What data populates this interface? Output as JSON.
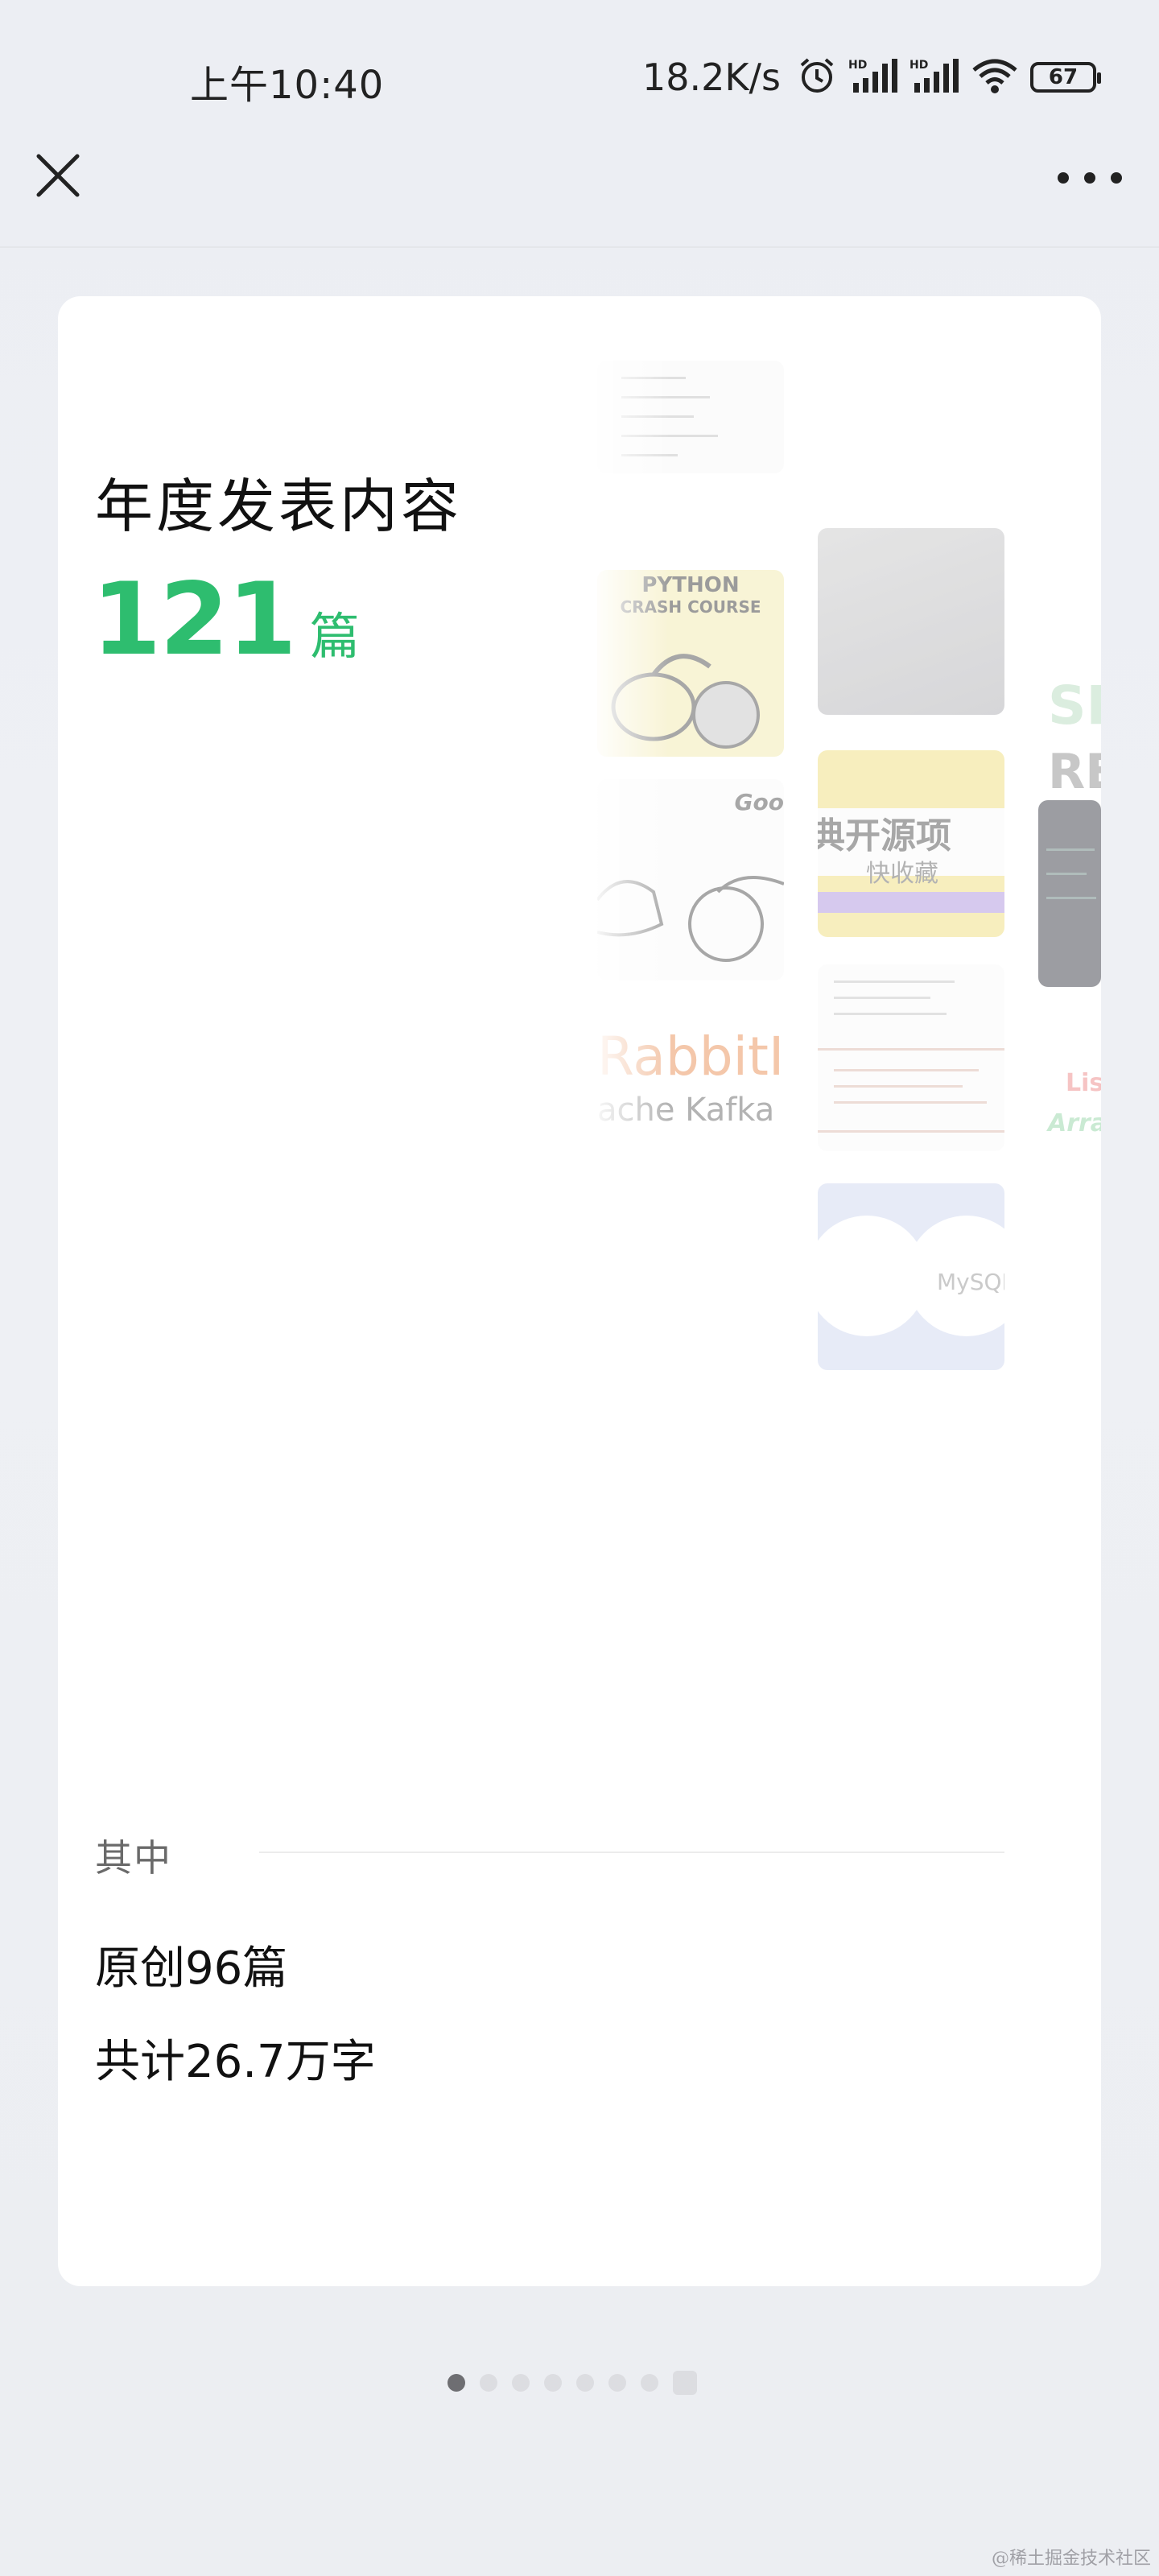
{
  "status_bar": {
    "time": "上午10:40",
    "net_speed": "18.2K/s",
    "battery": "67",
    "icons": [
      "alarm-icon",
      "hd-signal-icon",
      "hd-signal-icon",
      "wifi-icon",
      "battery-icon"
    ]
  },
  "nav": {
    "close_icon": "close-icon",
    "more_icon": "more-icon"
  },
  "main": {
    "title": "年度发表内容",
    "count": "121",
    "count_unit": "篇"
  },
  "collage": {
    "python_line1": "PYTHON",
    "python_line2": "CRASH COURSE",
    "open_source": "典开源项",
    "favorite": "快收藏",
    "good": "Goo",
    "rabbit": "RabbitI",
    "kafka": "ache Kafka",
    "mysql": "MySQL",
    "sp": "SP",
    "re": "RE",
    "lis": "Lis",
    "array": "Array"
  },
  "stats": {
    "among_label": "其中",
    "original": "原创96篇",
    "words": "共计26.7万字"
  },
  "pager": {
    "total": 8,
    "active_index": 0
  },
  "watermark": "@稀土掘金技术社区",
  "colors": {
    "accent_green": "#2ebd6f",
    "background": "#eceef3",
    "card": "#ffffff"
  }
}
